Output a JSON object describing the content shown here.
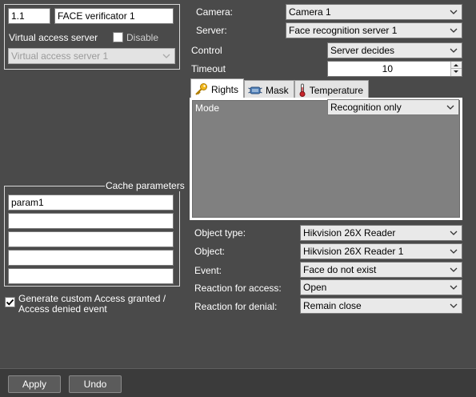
{
  "left": {
    "id_value": "1.1",
    "name_value": "FACE verificator 1",
    "virtual_access_server_label": "Virtual access server",
    "disable_label": "Disable",
    "disable_checked": false,
    "virtual_access_server_value": "Virtual access server 1",
    "cache": {
      "title": "Cache parameters",
      "params": [
        "param1",
        "",
        "",
        "",
        ""
      ]
    },
    "generate_event_label_line1": "Generate custom Access granted /",
    "generate_event_label_line2": "Access denied event",
    "generate_event_checked": true
  },
  "right": {
    "camera_label": "Camera:",
    "camera_value": "Camera 1",
    "server_label": "Server:",
    "server_value": "Face recognition server 1",
    "control_label": "Control",
    "control_value": "Server decides",
    "timeout_label": "Timeout",
    "timeout_value": "10",
    "tabs": {
      "rights": "Rights",
      "mask": "Mask",
      "temperature": "Temperature"
    },
    "mode_label": "Mode",
    "mode_value": "Recognition only",
    "object_type_label": "Object type:",
    "object_type_value": "Hikvision 26X Reader",
    "object_label": "Object:",
    "object_value": "Hikvision 26X Reader 1",
    "event_label": "Event:",
    "event_value": "Face do not exist",
    "reaction_access_label": "Reaction for access:",
    "reaction_access_value": "Open",
    "reaction_denial_label": "Reaction for denial:",
    "reaction_denial_value": "Remain close"
  },
  "footer": {
    "apply_label": "Apply",
    "undo_label": "Undo"
  }
}
